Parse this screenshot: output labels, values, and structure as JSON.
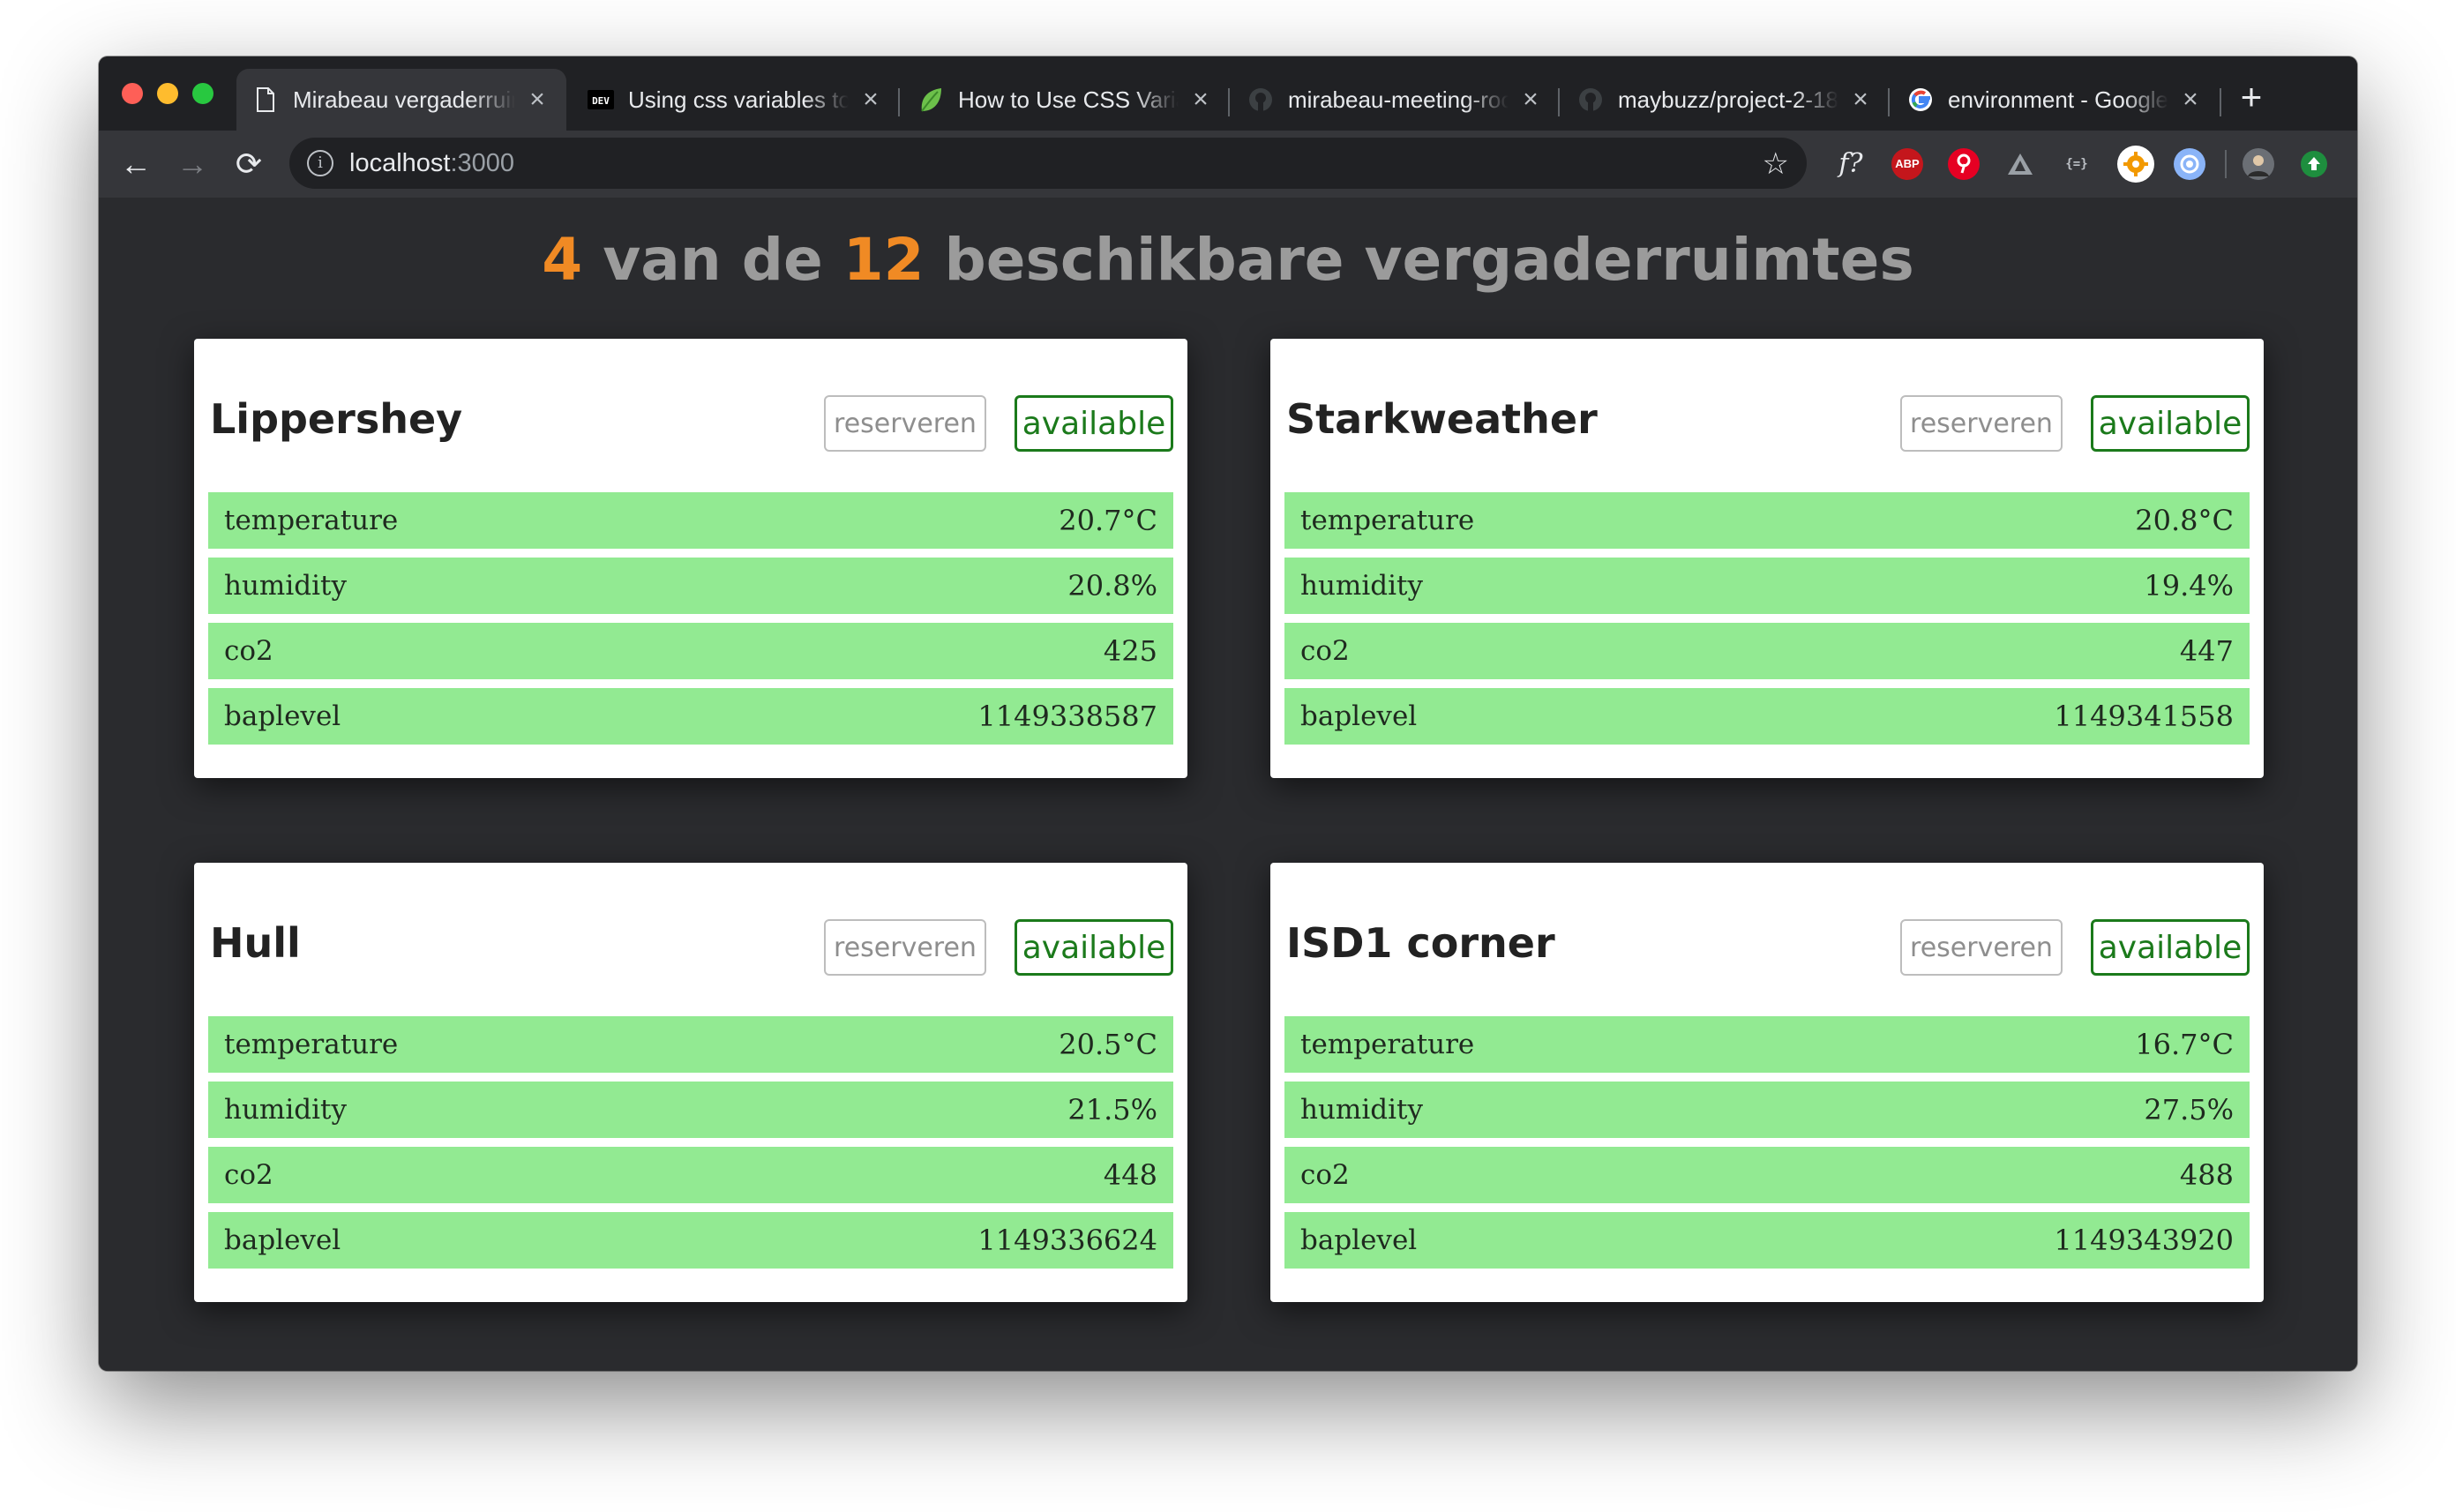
{
  "browser": {
    "tabs": [
      {
        "title": "Mirabeau vergaderruimtes",
        "icon": "document-icon",
        "active": true
      },
      {
        "title": "Using css variables to",
        "icon": "dev-logo-icon",
        "active": false
      },
      {
        "title": "How to Use CSS Variables",
        "icon": "leaf-icon",
        "active": false
      },
      {
        "title": "mirabeau-meeting-rooms",
        "icon": "github-icon",
        "active": false
      },
      {
        "title": "maybuzz/project-2-18",
        "icon": "github-icon",
        "active": false
      },
      {
        "title": "environment - Google",
        "icon": "google-icon",
        "active": false
      }
    ],
    "new_tab_glyph": "+",
    "url_host": "localhost",
    "url_port": ":3000",
    "extensions": [
      "font-icon",
      "adblock-icon",
      "pinterest-icon",
      "drive-icon",
      "json-icon",
      "settings-icon",
      "color-picker-icon",
      "avatar-icon",
      "update-icon"
    ],
    "extension_labels": {
      "font": "f?",
      "adblock": "ABP",
      "json": "{=}"
    }
  },
  "header": {
    "available_count": "4",
    "text_mid": "van de",
    "total_count": "12",
    "text_end": "beschikbare vergaderruimtes",
    "accent_color": "#f08a24"
  },
  "rooms": [
    {
      "name": "Lippershey",
      "reserve_label": "reserveren",
      "status_label": "available",
      "metrics": [
        {
          "label": "temperature",
          "value": "20.7°C"
        },
        {
          "label": "humidity",
          "value": "20.8%"
        },
        {
          "label": "co2",
          "value": "425"
        },
        {
          "label": "baplevel",
          "value": "1149338587"
        }
      ]
    },
    {
      "name": "Starkweather",
      "reserve_label": "reserveren",
      "status_label": "available",
      "metrics": [
        {
          "label": "temperature",
          "value": "20.8°C"
        },
        {
          "label": "humidity",
          "value": "19.4%"
        },
        {
          "label": "co2",
          "value": "447"
        },
        {
          "label": "baplevel",
          "value": "1149341558"
        }
      ]
    },
    {
      "name": "Hull",
      "reserve_label": "reserveren",
      "status_label": "available",
      "metrics": [
        {
          "label": "temperature",
          "value": "20.5°C"
        },
        {
          "label": "humidity",
          "value": "21.5%"
        },
        {
          "label": "co2",
          "value": "448"
        },
        {
          "label": "baplevel",
          "value": "1149336624"
        }
      ]
    },
    {
      "name": "ISD1 corner",
      "reserve_label": "reserveren",
      "status_label": "available",
      "metrics": [
        {
          "label": "temperature",
          "value": "16.7°C"
        },
        {
          "label": "humidity",
          "value": "27.5%"
        },
        {
          "label": "co2",
          "value": "488"
        },
        {
          "label": "baplevel",
          "value": "1149343920"
        }
      ]
    }
  ],
  "colors": {
    "page_background": "#2a2b2e",
    "metric_background": "#92ea92",
    "status_green": "#1b7a1b"
  }
}
